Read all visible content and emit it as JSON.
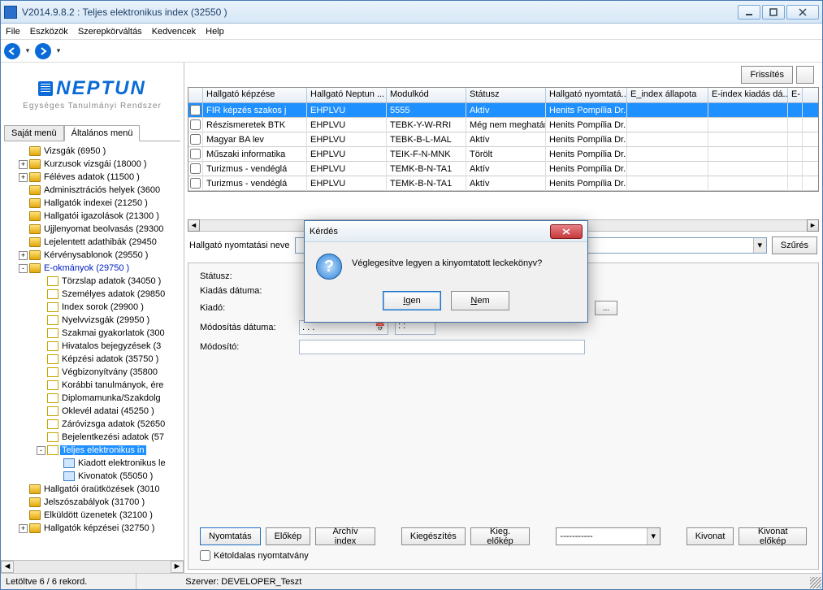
{
  "window": {
    "title": "V2014.9.8.2 : Teljes elektronikus index (32550  )"
  },
  "menus": [
    "File",
    "Eszközök",
    "Szerepkörváltás",
    "Kedvencek",
    "Help"
  ],
  "logo": {
    "top": "NEPTUN",
    "sub": "Egységes Tanulmányi Rendszer"
  },
  "sideTabs": {
    "my": "Saját menü",
    "general": "Általános menü"
  },
  "tree": {
    "items": [
      {
        "lvl": 1,
        "type": "folder",
        "toggle": "",
        "label": "Vizsgák (6950 )",
        "name": "tree-vizsgak"
      },
      {
        "lvl": 1,
        "type": "folder",
        "toggle": "+",
        "label": "Kurzusok vizsgái (18000 )",
        "name": "tree-kurzusok-vizsgai"
      },
      {
        "lvl": 1,
        "type": "folder",
        "toggle": "+",
        "label": "Féléves adatok (11500 )",
        "name": "tree-feleves-adatok"
      },
      {
        "lvl": 1,
        "type": "folder",
        "toggle": "",
        "label": "Adminisztrációs helyek (3600",
        "name": "tree-admin-helyek"
      },
      {
        "lvl": 1,
        "type": "folder",
        "toggle": "",
        "label": "Hallgatók indexei (21250 )",
        "name": "tree-hallgatok-indexei"
      },
      {
        "lvl": 1,
        "type": "folder",
        "toggle": "",
        "label": "Hallgatói igazolások (21300 )",
        "name": "tree-hallgatoi-igazolasok"
      },
      {
        "lvl": 1,
        "type": "folder",
        "toggle": "",
        "label": "Ujjlenyomat beolvasás (29300",
        "name": "tree-ujjlenyomat"
      },
      {
        "lvl": 1,
        "type": "folder",
        "toggle": "",
        "label": "Lejelentett adathibák (29450",
        "name": "tree-lejelentett-adathibak"
      },
      {
        "lvl": 1,
        "type": "folder",
        "toggle": "+",
        "label": "Kérvénysablonok (29550 )",
        "name": "tree-kervenysablonok"
      },
      {
        "lvl": 1,
        "type": "folder",
        "toggle": "-",
        "label": "E-okmányok (29750 )",
        "blue": true,
        "name": "tree-e-okmanyok"
      },
      {
        "lvl": 2,
        "type": "doc",
        "toggle": "",
        "label": "Törzslap adatok (34050 )",
        "name": "tree-torzslap"
      },
      {
        "lvl": 2,
        "type": "doc",
        "toggle": "",
        "label": "Személyes adatok (29850",
        "name": "tree-szemelyes"
      },
      {
        "lvl": 2,
        "type": "doc",
        "toggle": "",
        "label": "Index sorok (29900 )",
        "name": "tree-index-sorok"
      },
      {
        "lvl": 2,
        "type": "doc",
        "toggle": "",
        "label": "Nyelvvizsgák (29950 )",
        "name": "tree-nyelvvizsgak"
      },
      {
        "lvl": 2,
        "type": "doc",
        "toggle": "",
        "label": "Szakmai gyakorlatok (300",
        "name": "tree-szakmai-gyak"
      },
      {
        "lvl": 2,
        "type": "doc",
        "toggle": "",
        "label": "Hivatalos bejegyzések (3",
        "name": "tree-hivatalos-bejegyzesek"
      },
      {
        "lvl": 2,
        "type": "doc",
        "toggle": "",
        "label": "Képzési adatok (35750 )",
        "name": "tree-kepzesi-adatok"
      },
      {
        "lvl": 2,
        "type": "doc",
        "toggle": "",
        "label": "Végbizonyítvány (35800",
        "name": "tree-vegbizonyitvany"
      },
      {
        "lvl": 2,
        "type": "doc",
        "toggle": "",
        "label": "Korábbi tanulmányok, ére",
        "name": "tree-korabbi-tanulmanyok"
      },
      {
        "lvl": 2,
        "type": "doc",
        "toggle": "",
        "label": "Diplomamunka/Szakdolg",
        "name": "tree-diplomamunka"
      },
      {
        "lvl": 2,
        "type": "doc",
        "toggle": "",
        "label": "Oklevél adatai (45250 )",
        "name": "tree-oklevel-adatai"
      },
      {
        "lvl": 2,
        "type": "doc",
        "toggle": "",
        "label": "Záróvizsga adatok (52650",
        "name": "tree-zarovizsga"
      },
      {
        "lvl": 2,
        "type": "doc",
        "toggle": "",
        "label": "Bejelentkezési adatok (57",
        "name": "tree-bejelentkezesi"
      },
      {
        "lvl": 2,
        "type": "doc",
        "toggle": "-",
        "label": "Teljes elektronikus in",
        "selected": true,
        "name": "tree-teljes-elektronikus-index"
      },
      {
        "lvl": 3,
        "type": "docblue",
        "toggle": "",
        "label": "Kiadott elektronikus le",
        "name": "tree-kiadott-elektronikus"
      },
      {
        "lvl": 3,
        "type": "docblue",
        "toggle": "",
        "label": "Kivonatok (55050 )",
        "name": "tree-kivonatok"
      },
      {
        "lvl": 1,
        "type": "folder",
        "toggle": "",
        "label": "Hallgatói óraütközések (3010",
        "name": "tree-orautkozesek"
      },
      {
        "lvl": 1,
        "type": "folder",
        "toggle": "",
        "label": "Jelszószabályok (31700 )",
        "name": "tree-jelszoszabalyok"
      },
      {
        "lvl": 1,
        "type": "folder",
        "toggle": "",
        "label": "Elküldött üzenetek (32100 )",
        "name": "tree-elkuldott-uzenetek"
      },
      {
        "lvl": 1,
        "type": "folder",
        "toggle": "+",
        "label": "Hallgatók képzései (32750 )",
        "name": "tree-hallgatok-kepzesei"
      }
    ]
  },
  "topActions": {
    "refresh": "Frissítés"
  },
  "grid": {
    "headers": [
      "Hallgató képzése",
      "Hallgató Neptun ...",
      "Modulkód",
      "Státusz",
      "Hallgató nyomtatá...",
      "E_index állapota",
      "E-index kiadás dá...",
      "E-"
    ],
    "rows": [
      {
        "sel": true,
        "cells": [
          "FIR képzés szakos j",
          "EHPLVU",
          "5555",
          "Aktív",
          "Henits Pompília Dr.",
          "",
          "",
          ""
        ]
      },
      {
        "cells": [
          "Részismeretek BTK",
          "EHPLVU",
          "TEBK-Y-W-RRI",
          "Még nem meghatáro",
          "Henits Pompília Dr.",
          "",
          "",
          ""
        ]
      },
      {
        "cells": [
          "Magyar BA lev",
          "EHPLVU",
          "TEBK-B-L-MAL",
          "Aktív",
          "Henits Pompília Dr.",
          "",
          "",
          ""
        ]
      },
      {
        "cells": [
          "Műszaki informatika",
          "EHPLVU",
          "TEIK-F-N-MNK",
          "Törölt",
          "Henits Pompília Dr.",
          "",
          "",
          ""
        ]
      },
      {
        "cells": [
          "Turizmus - vendéglá",
          "EHPLVU",
          "TEMK-B-N-TA1",
          "Aktív",
          "Henits Pompília Dr.",
          "",
          "",
          ""
        ]
      },
      {
        "cells": [
          "Turizmus - vendéglá",
          "EHPLVU",
          "TEMK-B-N-TA1",
          "Aktív",
          "Henits Pompília Dr.",
          "",
          "",
          ""
        ]
      }
    ]
  },
  "filter": {
    "label": "Hallgató nyomtatási neve",
    "button": "Szűrés"
  },
  "form": {
    "status_label": "Státusz:",
    "issue_date_label": "Kiadás dátuma:",
    "issuer_label": "Kiadó:",
    "mod_date_label": "Módosítás dátuma:",
    "modifier_label": "Módosító:",
    "date_placeholder": " .  .  .",
    "time_placeholder": " :  : "
  },
  "buttons": {
    "print": "Nyomtatás",
    "preview": "Előkép",
    "archive": "Archív index",
    "supplement": "Kiegészítés",
    "supp_preview": "Kieg. előkép",
    "combo_value": "-----------",
    "extract": "Kivonat",
    "extract_preview": "Kivonat előkép",
    "duplex": "Kétoldalas nyomtatvány"
  },
  "status": {
    "left": "Letöltve 6 / 6 rekord.",
    "server": "Szerver: DEVELOPER_Teszt"
  },
  "modal": {
    "title": "Kérdés",
    "message": "Véglegesítve legyen a kinyomtatott leckekönyv?",
    "yes": "Igen",
    "no": "Nem"
  }
}
